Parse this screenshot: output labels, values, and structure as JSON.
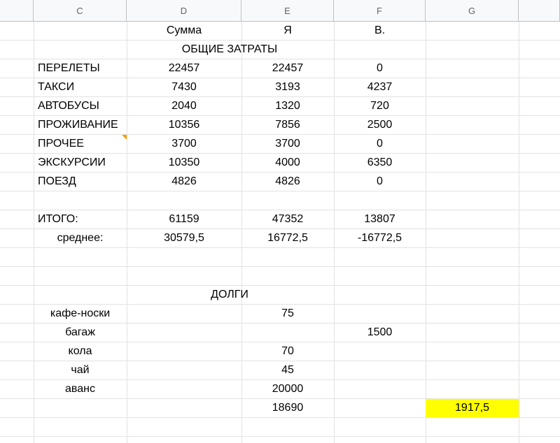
{
  "columns": [
    "C",
    "D",
    "E",
    "F",
    "G"
  ],
  "rows": [
    {
      "D": "Сумма",
      "E": "Я",
      "F": "В."
    },
    {
      "merged": "ОБЩИЕ ЗАТРАТЫ"
    },
    {
      "C": "ПЕРЕЛЕТЫ",
      "D": "22457",
      "E": "22457",
      "F": "0"
    },
    {
      "C": "ТАКСИ",
      "D": "7430",
      "E": "3193",
      "F": "4237"
    },
    {
      "C": "АВТОБУСЫ",
      "D": "2040",
      "E": "1320",
      "F": "720"
    },
    {
      "C": "ПРОЖИВАНИЕ",
      "D": "10356",
      "E": "7856",
      "F": "2500"
    },
    {
      "C": "ПРОЧЕЕ",
      "D": "3700",
      "E": "3700",
      "F": "0",
      "note": true
    },
    {
      "C": "ЭКСКУРСИИ",
      "D": "10350",
      "E": "4000",
      "F": "6350"
    },
    {
      "C": "ПОЕЗД",
      "D": "4826",
      "E": "4826",
      "F": "0"
    },
    {},
    {
      "C": "ИТОГО:",
      "D": "61159",
      "E": "47352",
      "F": "13807"
    },
    {
      "C_center": "среднее:",
      "D": "30579,5",
      "E": "16772,5",
      "F": "-16772,5"
    },
    {},
    {},
    {
      "merged": "ДОЛГИ"
    },
    {
      "C_center": "кафе-носки",
      "E": "75"
    },
    {
      "C_center": "багаж",
      "F": "1500"
    },
    {
      "C_center": "кола",
      "E": "70"
    },
    {
      "C_center": "чай",
      "E": "45"
    },
    {
      "C_center": "аванс",
      "E": "20000"
    },
    {
      "E": "18690",
      "G_highlight": "1917,5"
    },
    {}
  ],
  "colors": {
    "highlight": "#ffff00",
    "note_indicator": "#f4a300"
  }
}
